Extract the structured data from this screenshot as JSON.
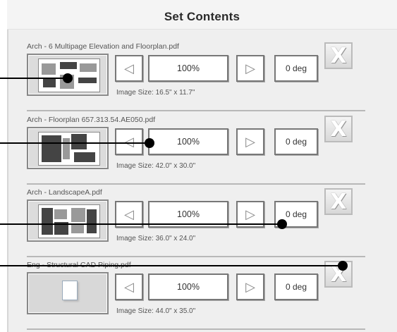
{
  "header": {
    "title": "Set Contents"
  },
  "items": [
    {
      "filename": "Arch - 6 Multipage Elevation and Floorplan.pdf",
      "zoom": "100%",
      "rotation": "0 deg",
      "image_size": "Image Size: 16.5\" x 11.7\""
    },
    {
      "filename": "Arch - Floorplan 657.313.54.AE050.pdf",
      "zoom": "100%",
      "rotation": "0 deg",
      "image_size": "Image Size: 42.0\" x 30.0\""
    },
    {
      "filename": "Arch - LandscapeA.pdf",
      "zoom": "100%",
      "rotation": "0 deg",
      "image_size": "Image Size: 36.0\" x 24.0\""
    },
    {
      "filename": "Eng - Structural CAD Piping.pdf",
      "zoom": "100%",
      "rotation": "0 deg",
      "image_size": "Image Size: 44.0\" x 35.0\""
    }
  ],
  "icons": {
    "left": "left-arrow-icon",
    "right": "right-arrow-icon",
    "remove": "remove-x-icon",
    "document": "document-icon"
  },
  "glyphs": {
    "left": "◁",
    "right": "▷",
    "remove": "X"
  },
  "colors": {
    "panel": "#efefef",
    "callout": "#000000"
  }
}
